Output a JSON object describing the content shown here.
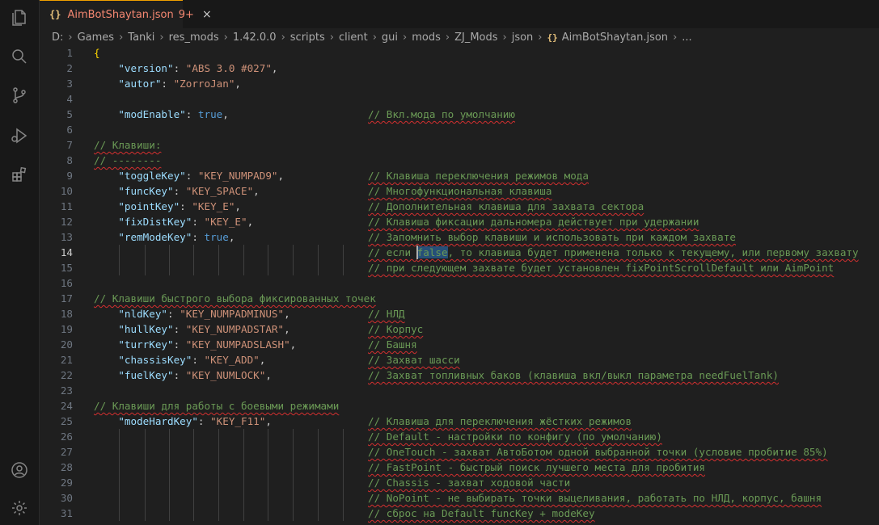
{
  "tab": {
    "icon": "{}",
    "name": "AimBotShaytan.json",
    "badge": "9+",
    "close": "×"
  },
  "breadcrumb": [
    "D:",
    "Games",
    "Tanki",
    "res_mods",
    "1.42.0.0",
    "scripts",
    "client",
    "gui",
    "mods",
    "ZJ_Mods",
    "json"
  ],
  "breadcrumb_file": {
    "icon": "{}",
    "name": "AimBotShaytan.json",
    "tail": "..."
  },
  "lines": [
    {
      "n": "1",
      "brace": "{"
    },
    {
      "n": "2",
      "k": "\"version\"",
      "v": "\"ABS 3.0 #027\"",
      "vt": "str",
      "p": ","
    },
    {
      "n": "3",
      "k": "\"autor\"",
      "v": "\"ZorroJan\"",
      "vt": "str",
      "p": ","
    },
    {
      "n": "4"
    },
    {
      "n": "5",
      "k": "\"modEnable\"",
      "v": "true",
      "vt": "kw",
      "p": ",",
      "c": "// Вкл.мода по умолчанию"
    },
    {
      "n": "6"
    },
    {
      "n": "7",
      "full": "// Клавиши:"
    },
    {
      "n": "8",
      "full": "// --------"
    },
    {
      "n": "9",
      "k": "\"toggleKey\"",
      "v": "\"KEY_NUMPAD9\"",
      "vt": "str",
      "p": ",",
      "c": "// Клавиша переключения режимов мода"
    },
    {
      "n": "10",
      "k": "\"funcKey\"",
      "v": "\"KEY_SPACE\"",
      "vt": "str",
      "p": ",",
      "c": "// Многофункциональная клавиша"
    },
    {
      "n": "11",
      "k": "\"pointKey\"",
      "v": "\"KEY_E\"",
      "vt": "str",
      "p": ",",
      "c": "// Дополнительная клавиша для захвата сектора"
    },
    {
      "n": "12",
      "k": "\"fixDistKey\"",
      "v": "\"KEY_E\"",
      "vt": "str",
      "p": ",",
      "c": "// Клавиша фиксации дальномера действует при удержании"
    },
    {
      "n": "13",
      "k": "\"remModeKey\"",
      "v": "true",
      "vt": "kw",
      "p": ",",
      "c": "// Запомнить выбор клавиши и использовать при каждом захвате"
    },
    {
      "n": "14",
      "c": "// если false, то клавиша будет применена только к текущему, или первому захвату",
      "active": true
    },
    {
      "n": "15",
      "c": "// при следующем захвате будет установлен fixPointScrollDefault или AimPoint"
    },
    {
      "n": "16"
    },
    {
      "n": "17",
      "full": "// Клавиши быстрого выбора фиксированных точек"
    },
    {
      "n": "18",
      "k": "\"nldKey\"",
      "v": "\"KEY_NUMPADMINUS\"",
      "vt": "str",
      "p": ",",
      "c": "// НЛД"
    },
    {
      "n": "19",
      "k": "\"hullKey\"",
      "v": "\"KEY_NUMPADSTAR\"",
      "vt": "str",
      "p": ",",
      "c": "// Корпус"
    },
    {
      "n": "20",
      "k": "\"turrKey\"",
      "v": "\"KEY_NUMPADSLASH\"",
      "vt": "str",
      "p": ",",
      "c": "// Башня"
    },
    {
      "n": "21",
      "k": "\"chassisKey\"",
      "v": "\"KEY_ADD\"",
      "vt": "str",
      "p": ",",
      "c": "// Захват шасси"
    },
    {
      "n": "22",
      "k": "\"fuelKey\"",
      "v": "\"KEY_NUMLOCK\"",
      "vt": "str",
      "p": ",",
      "c": "// Захват топливных баков (клавиша вкл/выкл параметра needFuelTank)"
    },
    {
      "n": "23"
    },
    {
      "n": "24",
      "full": "// Клавиши для работы с боевыми режимами"
    },
    {
      "n": "25",
      "k": "\"modeHardKey\"",
      "v": "\"KEY_F11\"",
      "vt": "str",
      "p": ",",
      "c": "// Клавиша для переключения жёстких режимов"
    },
    {
      "n": "26",
      "c": "// Default - настройки по конфигу (по умолчанию)"
    },
    {
      "n": "27",
      "c": "// OneTouch - захват АвтоБотом одной выбранной точки (условие пробитие 85%)"
    },
    {
      "n": "28",
      "c": "// FastPoint - быстрый поиск лучшего места для пробития"
    },
    {
      "n": "29",
      "c": "// Chassis - захват ходовой части"
    },
    {
      "n": "30",
      "c": "// NoPoint - не выбирать точки выцеливания, работать по НЛД, корпус, башня"
    },
    {
      "n": "31",
      "c": "// сброс на Default funcKey + modeKey"
    }
  ],
  "selection_word": "false",
  "colors": {
    "key": "#9cdcfe",
    "string": "#ce9178",
    "keyword": "#569cd6",
    "comment": "#6a9955",
    "tab_modified": "#f48771"
  }
}
